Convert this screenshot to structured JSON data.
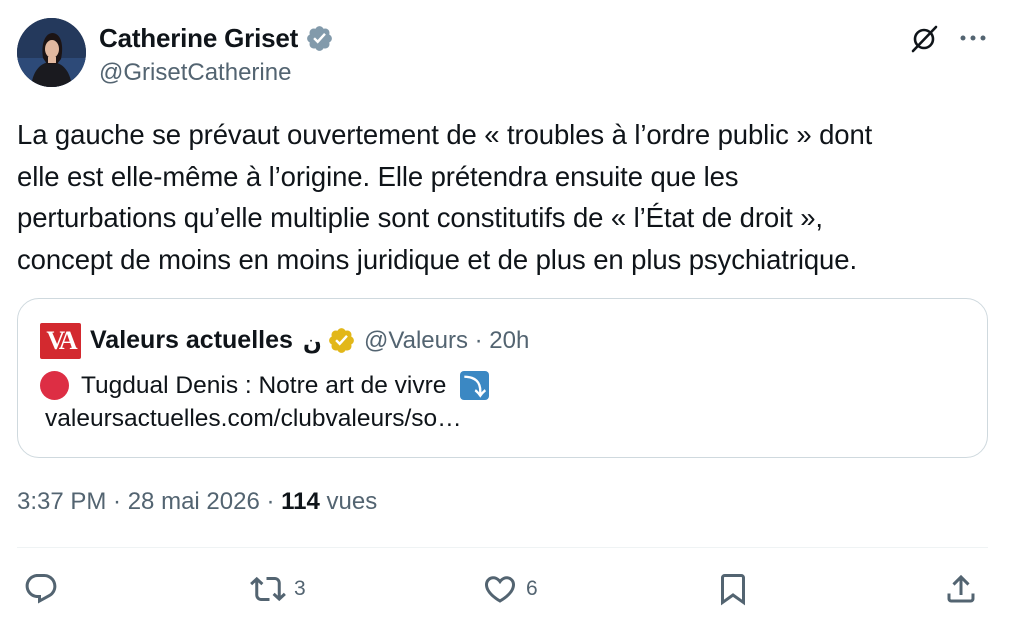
{
  "author": {
    "name": "Catherine Griset",
    "handle": "@GrisetCatherine",
    "verified_color": "#829aab"
  },
  "tweet": {
    "lines": [
      "La gauche se prévaut ouvertement de « troubles à l’ordre public » dont",
      "elle est elle-même à l’origine. Elle prétendra ensuite que les",
      "perturbations qu’elle multiplie sont constitutifs de « l’État de droit »,",
      "concept de moins en moins juridique et de plus en plus psychiatrique."
    ]
  },
  "quote": {
    "logo_text": "VA",
    "name": "Valeurs actuelles",
    "arabic": "ن",
    "meta": "@Valeurs · 20h",
    "line1": "Tugdual Denis : Notre art de vivre",
    "link": "valeursactuelles.com/clubvaleurs/so…",
    "verified_color": "#e2b719",
    "brand_color": "#d3292f"
  },
  "meta": {
    "time_date": "3:37 PM · 28 mai 2026 · ",
    "views_count": "114",
    "views_label": " vues"
  },
  "actions": {
    "reply": {
      "icon": "reply-icon",
      "count": ""
    },
    "retweet": {
      "icon": "retweet-icon",
      "count": "3"
    },
    "like": {
      "icon": "heart-icon",
      "count": "6"
    },
    "bookmark": {
      "icon": "bookmark-icon"
    },
    "share": {
      "icon": "share-icon"
    }
  }
}
